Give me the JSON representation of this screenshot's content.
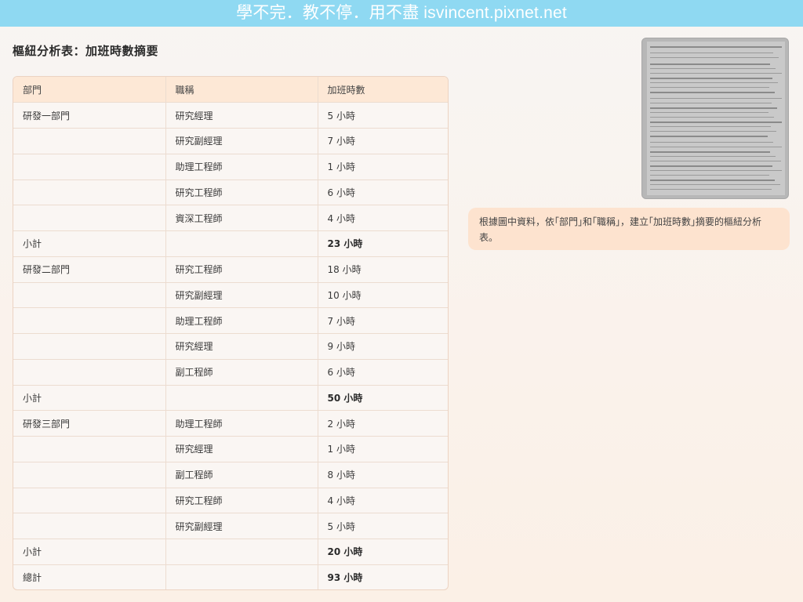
{
  "banner": {
    "text": "學不完．教不停．用不盡 isvincent.pixnet.net"
  },
  "page_title": "樞紐分析表：加班時數摘要",
  "table": {
    "headers": [
      "部門",
      "職稱",
      "加班時數"
    ],
    "rows": [
      [
        "研發一部門",
        "研究經理",
        "5 小時"
      ],
      [
        "",
        "研究副經理",
        "7 小時"
      ],
      [
        "",
        "助理工程師",
        "1 小時"
      ],
      [
        "",
        "研究工程師",
        "6 小時"
      ],
      [
        "",
        "資深工程師",
        "4 小時"
      ],
      [
        "小計",
        "",
        "23 小時"
      ],
      [
        "研發二部門",
        "研究工程師",
        "18 小時"
      ],
      [
        "",
        "研究副經理",
        "10 小時"
      ],
      [
        "",
        "助理工程師",
        "7 小時"
      ],
      [
        "",
        "研究經理",
        "9 小時"
      ],
      [
        "",
        "副工程師",
        "6 小時"
      ],
      [
        "小計",
        "",
        "50 小時"
      ],
      [
        "研發三部門",
        "助理工程師",
        "2 小時"
      ],
      [
        "",
        "研究經理",
        "1 小時"
      ],
      [
        "",
        "副工程師",
        "8 小時"
      ],
      [
        "",
        "研究工程師",
        "4 小時"
      ],
      [
        "",
        "研究副經理",
        "5 小時"
      ],
      [
        "小計",
        "",
        "20 小時"
      ],
      [
        "總計",
        "",
        "93 小時"
      ]
    ],
    "bold_rows": [
      5,
      11,
      17,
      18
    ]
  },
  "chat": {
    "message": "根據圖中資料，依｢部門｣和｢職稱｣，建立｢加班時數｣摘要的樞紐分析表。"
  },
  "colors": {
    "banner_bg": "#8fd9f2",
    "header_bg": "#fde8d6",
    "bubble_bg": "#fde3cf"
  }
}
